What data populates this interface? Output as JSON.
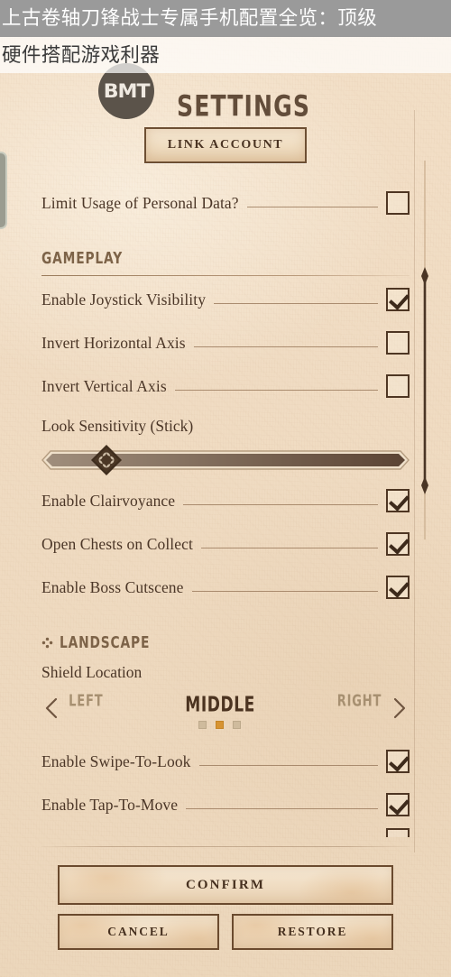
{
  "overlay": {
    "line1": "上古卷轴刀锋战士专属手机配置全览：顶级",
    "line2": "硬件搭配游戏利器"
  },
  "header": {
    "title": "SETTINGS",
    "logo_text": "BMT",
    "logo_icon": "bmt-circle-logo"
  },
  "account": {
    "link_button": "LINK ACCOUNT",
    "privacy_row": {
      "label": "Limit Usage of Personal Data?",
      "checked": false
    }
  },
  "gameplay": {
    "section_title": "GAMEPLAY",
    "rows": [
      {
        "label": "Enable Joystick Visibility",
        "checked": true
      },
      {
        "label": "Invert Horizontal Axis",
        "checked": false
      },
      {
        "label": "Invert Vertical Axis",
        "checked": false
      }
    ],
    "slider": {
      "label": "Look Sensitivity (Stick)",
      "value_percent": 16,
      "handle_icon": "diamond-quatrefoil-handle"
    },
    "rows2": [
      {
        "label": "Enable Clairvoyance",
        "checked": true
      },
      {
        "label": "Open Chests on Collect",
        "checked": true
      },
      {
        "label": "Enable Boss Cutscene",
        "checked": true
      }
    ]
  },
  "landscape": {
    "section_title": "LANDSCAPE",
    "section_glyph": "quatrefoil-icon",
    "selector": {
      "label": "Shield Location",
      "options": [
        "LEFT",
        "MIDDLE",
        "RIGHT"
      ],
      "selected_index": 1,
      "prev_icon": "chevron-left-icon",
      "next_icon": "chevron-right-icon"
    },
    "rows": [
      {
        "label": "Enable Swipe-To-Look",
        "checked": true
      },
      {
        "label": "Enable Tap-To-Move",
        "checked": true
      }
    ]
  },
  "scrollbar": {
    "icon": "vertical-scrollbar-diamond-caps",
    "thumb_top_percent": 30,
    "thumb_height_percent": 56
  },
  "edge_tab": {
    "icon": "edge-drawer-handle"
  },
  "footer": {
    "confirm": "CONFIRM",
    "cancel": "CANCEL",
    "restore": "RESTORE"
  },
  "colors": {
    "parchment": "#f0dcc3",
    "ink": "#4b3627",
    "ink_dark": "#3d2a1b",
    "accent_orange": "#d79331",
    "muted_dot": "#cfbb9d",
    "section_label": "#7d6348",
    "border_brown": "#6a4a2e",
    "banner_grey": "#9a9a9a"
  }
}
